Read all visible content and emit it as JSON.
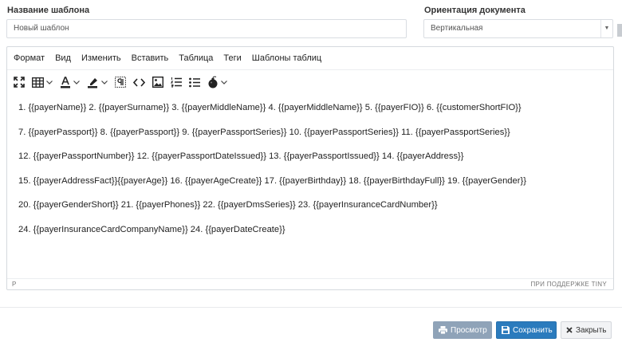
{
  "template_name": {
    "label": "Название шаблона",
    "value": "Новый шаблон"
  },
  "orientation": {
    "label": "Ориентация документа",
    "selected": "Вертикальная"
  },
  "editor": {
    "menu": [
      "Формат",
      "Вид",
      "Изменить",
      "Вставить",
      "Таблица",
      "Теги",
      "Шаблоны таблиц"
    ],
    "toolbar_icons": [
      "fullscreen-icon",
      "table-icon",
      "font-color-icon",
      "highlight-icon",
      "show-blocks-icon",
      "code-icon",
      "image-icon",
      "numbered-list-icon",
      "bullet-list-icon",
      "bomb-icon"
    ],
    "lines": [
      "1. {{payerName}} 2. {{payerSurname}} 3. {{payerMiddleName}}  4. {{payerMiddleName}}  5. {{payerFIO}}   6. {{customerShortFIO}}",
      "7. {{payerPassport}}  8. {{payerPassport}}   9. {{payerPassportSeries}}    10. {{payerPassportSeries}}  11. {{payerPassportSeries}}",
      "12. {{payerPassportNumber}}  12. {{payerPassportDateIssued}}  13. {{payerPassportIssued}}  14. {{payerAddress}}",
      "15. {{payerAddressFact}}{{payerAge}}  16. {{payerAgeCreate}}    17. {{payerBirthday}}  18. {{payerBirthdayFull}}  19. {{payerGender}}",
      "20. {{payerGenderShort}} 21. {{payerPhones}} 22. {{payerDmsSeries}}  23. {{payerInsuranceCardNumber}}",
      "24. {{payerInsuranceCardCompanyName}} 24. {{payerDateCreate}}"
    ],
    "status_path": "P",
    "status_brand": "ПРИ ПОДДЕРЖКЕ TINY"
  },
  "buttons": {
    "preview": "Просмотр",
    "save": "Сохранить",
    "close": "Закрыть"
  },
  "colors": {
    "save_button": "#2b7bbd",
    "preview_button": "#8fa3b8",
    "close_button": "#f2f3f5"
  }
}
